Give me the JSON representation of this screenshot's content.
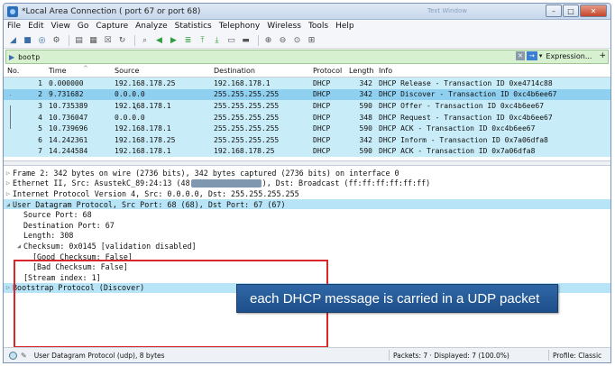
{
  "window": {
    "title": "*Local Area Connection ( port 67 or port 68)",
    "ghost_tab": "Text Window",
    "buttons": {
      "minimize": "–",
      "maximize": "□",
      "close": "✕"
    }
  },
  "menu": [
    "File",
    "Edit",
    "View",
    "Go",
    "Capture",
    "Analyze",
    "Statistics",
    "Telephony",
    "Wireless",
    "Tools",
    "Help"
  ],
  "filter": {
    "value": "bootp",
    "expression_label": "Expression...",
    "plus_label": "+",
    "accent": "#d6f0d0"
  },
  "packet_list": {
    "headers": [
      "No.",
      "Time",
      "Source",
      "Destination",
      "Protocol",
      "Length",
      "Info"
    ],
    "rows": [
      {
        "no": "1",
        "time": "0.000000",
        "src": "192.168.178.25",
        "dst": "192.168.178.1",
        "proto": "DHCP",
        "len": "342",
        "info": "DHCP Release  - Transaction ID 0xe4714c88",
        "selected": false
      },
      {
        "no": "2",
        "time": "9.731682",
        "src": "0.0.0.0",
        "dst": "255.255.255.255",
        "proto": "DHCP",
        "len": "342",
        "info": "DHCP Discover - Transaction ID 0xc4b6ee67",
        "selected": true
      },
      {
        "no": "3",
        "time": "10.735389",
        "src": "192.168.178.1",
        "dst": "255.255.255.255",
        "proto": "DHCP",
        "len": "590",
        "info": "DHCP Offer    - Transaction ID 0xc4b6ee67",
        "selected": false
      },
      {
        "no": "4",
        "time": "10.736047",
        "src": "0.0.0.0",
        "dst": "255.255.255.255",
        "proto": "DHCP",
        "len": "348",
        "info": "DHCP Request  - Transaction ID 0xc4b6ee67",
        "selected": false
      },
      {
        "no": "5",
        "time": "10.739696",
        "src": "192.168.178.1",
        "dst": "255.255.255.255",
        "proto": "DHCP",
        "len": "590",
        "info": "DHCP ACK      - Transaction ID 0xc4b6ee67",
        "selected": false
      },
      {
        "no": "6",
        "time": "14.242361",
        "src": "192.168.178.25",
        "dst": "255.255.255.255",
        "proto": "DHCP",
        "len": "342",
        "info": "DHCP Inform   - Transaction ID 0x7a06dfa8",
        "selected": false
      },
      {
        "no": "7",
        "time": "14.244584",
        "src": "192.168.178.1",
        "dst": "192.168.178.25",
        "proto": "DHCP",
        "len": "590",
        "info": "DHCP ACK      - Transaction ID 0x7a06dfa8",
        "selected": false
      }
    ]
  },
  "details": {
    "frame": "Frame 2: 342 bytes on wire (2736 bits), 342 bytes captured (2736 bits) on interface 0",
    "ethernet_pre": "Ethernet II, Src: AsustekC_89:24:13 (48",
    "ethernet_post": "), Dst: Broadcast (ff:ff:ff:ff:ff:ff)",
    "ip": "Internet Protocol Version 4, Src: 0.0.0.0, Dst: 255.255.255.255",
    "udp": "User Datagram Protocol, Src Port: 68 (68), Dst Port: 67 (67)",
    "udp_fields": {
      "src_port": "Source Port: 68",
      "dst_port": "Destination Port: 67",
      "length": "Length: 308",
      "checksum": "Checksum: 0x0145 [validation disabled]",
      "good_checksum": "[Good Checksum: False]",
      "bad_checksum": "[Bad Checksum: False]",
      "stream_index": "[Stream index: 1]"
    },
    "bootp": "Bootstrap Protocol (Discover)"
  },
  "callout": {
    "text": "each DHCP message is carried in a UDP packet",
    "color": "#2a5f9e"
  },
  "highlight_color": "#d9262c",
  "status": {
    "left": "User Datagram Protocol (udp), 8 bytes",
    "middle": "Packets: 7 · Displayed: 7 (100.0%)",
    "right": "Profile: Classic"
  }
}
